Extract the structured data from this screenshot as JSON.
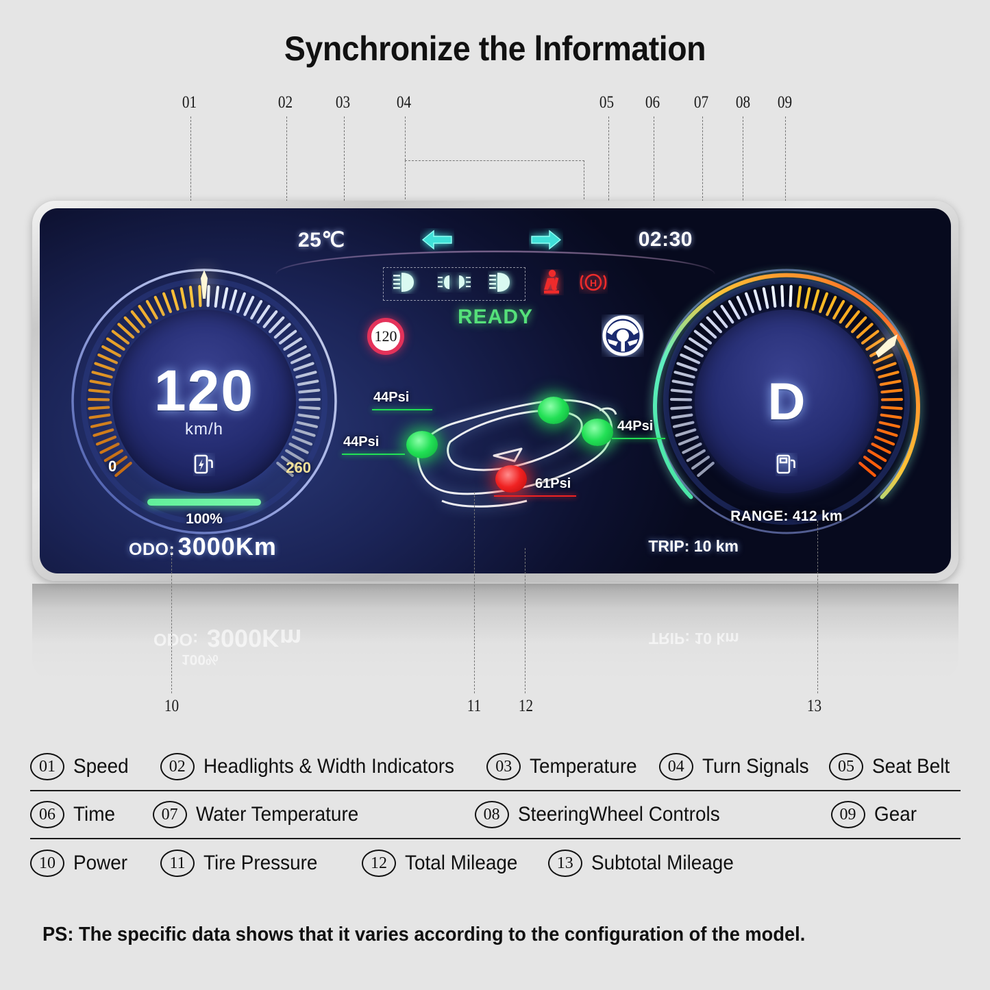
{
  "title": "Synchronize the lnformation",
  "footnote": "PS: The specific data shows that it varies according to the configuration of the model.",
  "callouts_top": [
    "01",
    "02",
    "03",
    "04",
    "05",
    "06",
    "07",
    "08",
    "09"
  ],
  "callouts_bottom": [
    "10",
    "11",
    "12",
    "13"
  ],
  "cluster": {
    "temperature": "25℃",
    "clock": "02:30",
    "status_text": "READY",
    "speed_limit_sign": "120",
    "left_gauge": {
      "speed_value": "120",
      "speed_unit": "km/h",
      "scale_min": "0",
      "scale_max": "260",
      "battery_percent": "100%",
      "battery_icon": "ev-charging-icon"
    },
    "right_gauge": {
      "gear": "D",
      "fuel_icon": "fuel-pump-icon",
      "range": "RANGE: 412 km"
    },
    "telltales": [
      {
        "name": "low-beam-headlight-icon",
        "color": "#d8f7ef"
      },
      {
        "name": "width-indicator-light-icon",
        "color": "#d8f7ef"
      },
      {
        "name": "high-beam-headlight-icon",
        "color": "#d8f7ef"
      },
      {
        "name": "seat-belt-warning-icon",
        "color": "#ef2b2b"
      },
      {
        "name": "parking-brake-icon",
        "color": "#ef2b2b"
      }
    ],
    "turn_signal_left": "turn-signal-left-icon",
    "turn_signal_right": "turn-signal-right-icon",
    "turn_signal_color": "#3fe0d8",
    "steering_wheel_icon": "steering-wheel-controls-icon",
    "tires": [
      {
        "position": "front-left",
        "value": "44Psi",
        "state": "ok",
        "color": "#22e055"
      },
      {
        "position": "front-right",
        "value": "44Psi",
        "state": "ok",
        "color": "#22e055"
      },
      {
        "position": "rear-right",
        "value": "44Psi",
        "state": "ok",
        "color": "#22e055"
      },
      {
        "position": "rear-left",
        "value": "61Psi",
        "state": "alert",
        "color": "#f02222"
      }
    ],
    "odo_label": "ODO:",
    "odo_value": "3000Km",
    "trip": "TRIP: 10 km"
  },
  "legend": {
    "rows": [
      [
        {
          "num": "01",
          "label": "Speed"
        },
        {
          "num": "02",
          "label": "Headlights & Width Indicators"
        },
        {
          "num": "03",
          "label": "Temperature"
        },
        {
          "num": "04",
          "label": "Turn Signals"
        },
        {
          "num": "05",
          "label": "Seat Belt"
        }
      ],
      [
        {
          "num": "06",
          "label": "Time"
        },
        {
          "num": "07",
          "label": "Water Temperature"
        },
        {
          "num": "08",
          "label": "SteeringWheel Controls"
        },
        {
          "num": "09",
          "label": "Gear"
        }
      ],
      [
        {
          "num": "10",
          "label": "Power"
        },
        {
          "num": "11",
          "label": "Tire Pressure"
        },
        {
          "num": "12",
          "label": "Total Mileage"
        },
        {
          "num": "13",
          "label": "Subtotal Mileage"
        }
      ]
    ]
  },
  "colors": {
    "background": "#e5e5e5",
    "bezel": "#c9c9c9",
    "screen_blue": "#1b2457",
    "accent_green": "#55e07a",
    "accent_cyan": "#3fe0d8",
    "accent_red": "#ef2b2b",
    "accent_amber": "#ffb41e"
  }
}
